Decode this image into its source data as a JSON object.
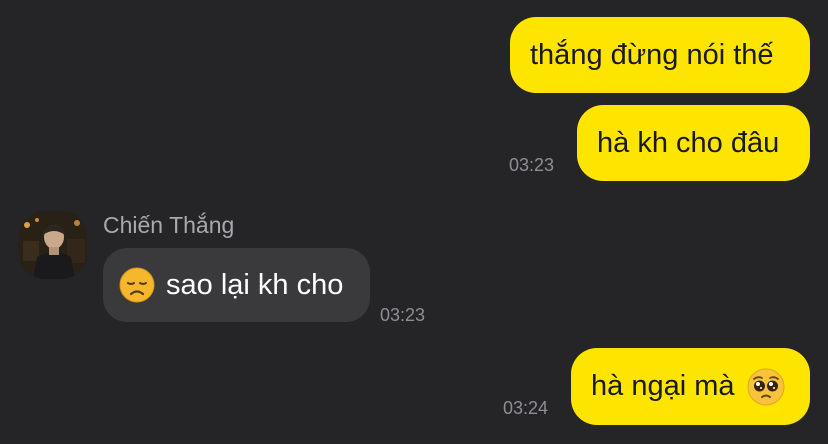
{
  "messages": {
    "m1": {
      "text": "thắng đừng nói thế"
    },
    "m2": {
      "text": "hà kh cho đâu",
      "time": "03:23"
    },
    "m3": {
      "sender": "Chiến Thắng",
      "emoji": "disappointed-face-emoji",
      "text": "sao lại kh cho",
      "time": "03:23"
    },
    "m4": {
      "text": "hà ngại mà",
      "emoji": "pleading-face-emoji",
      "time": "03:24"
    }
  },
  "colors": {
    "background": "#252527",
    "outgoing_bubble": "#fee500",
    "incoming_bubble": "#3a3a3c",
    "timestamp": "#8e8e93"
  }
}
